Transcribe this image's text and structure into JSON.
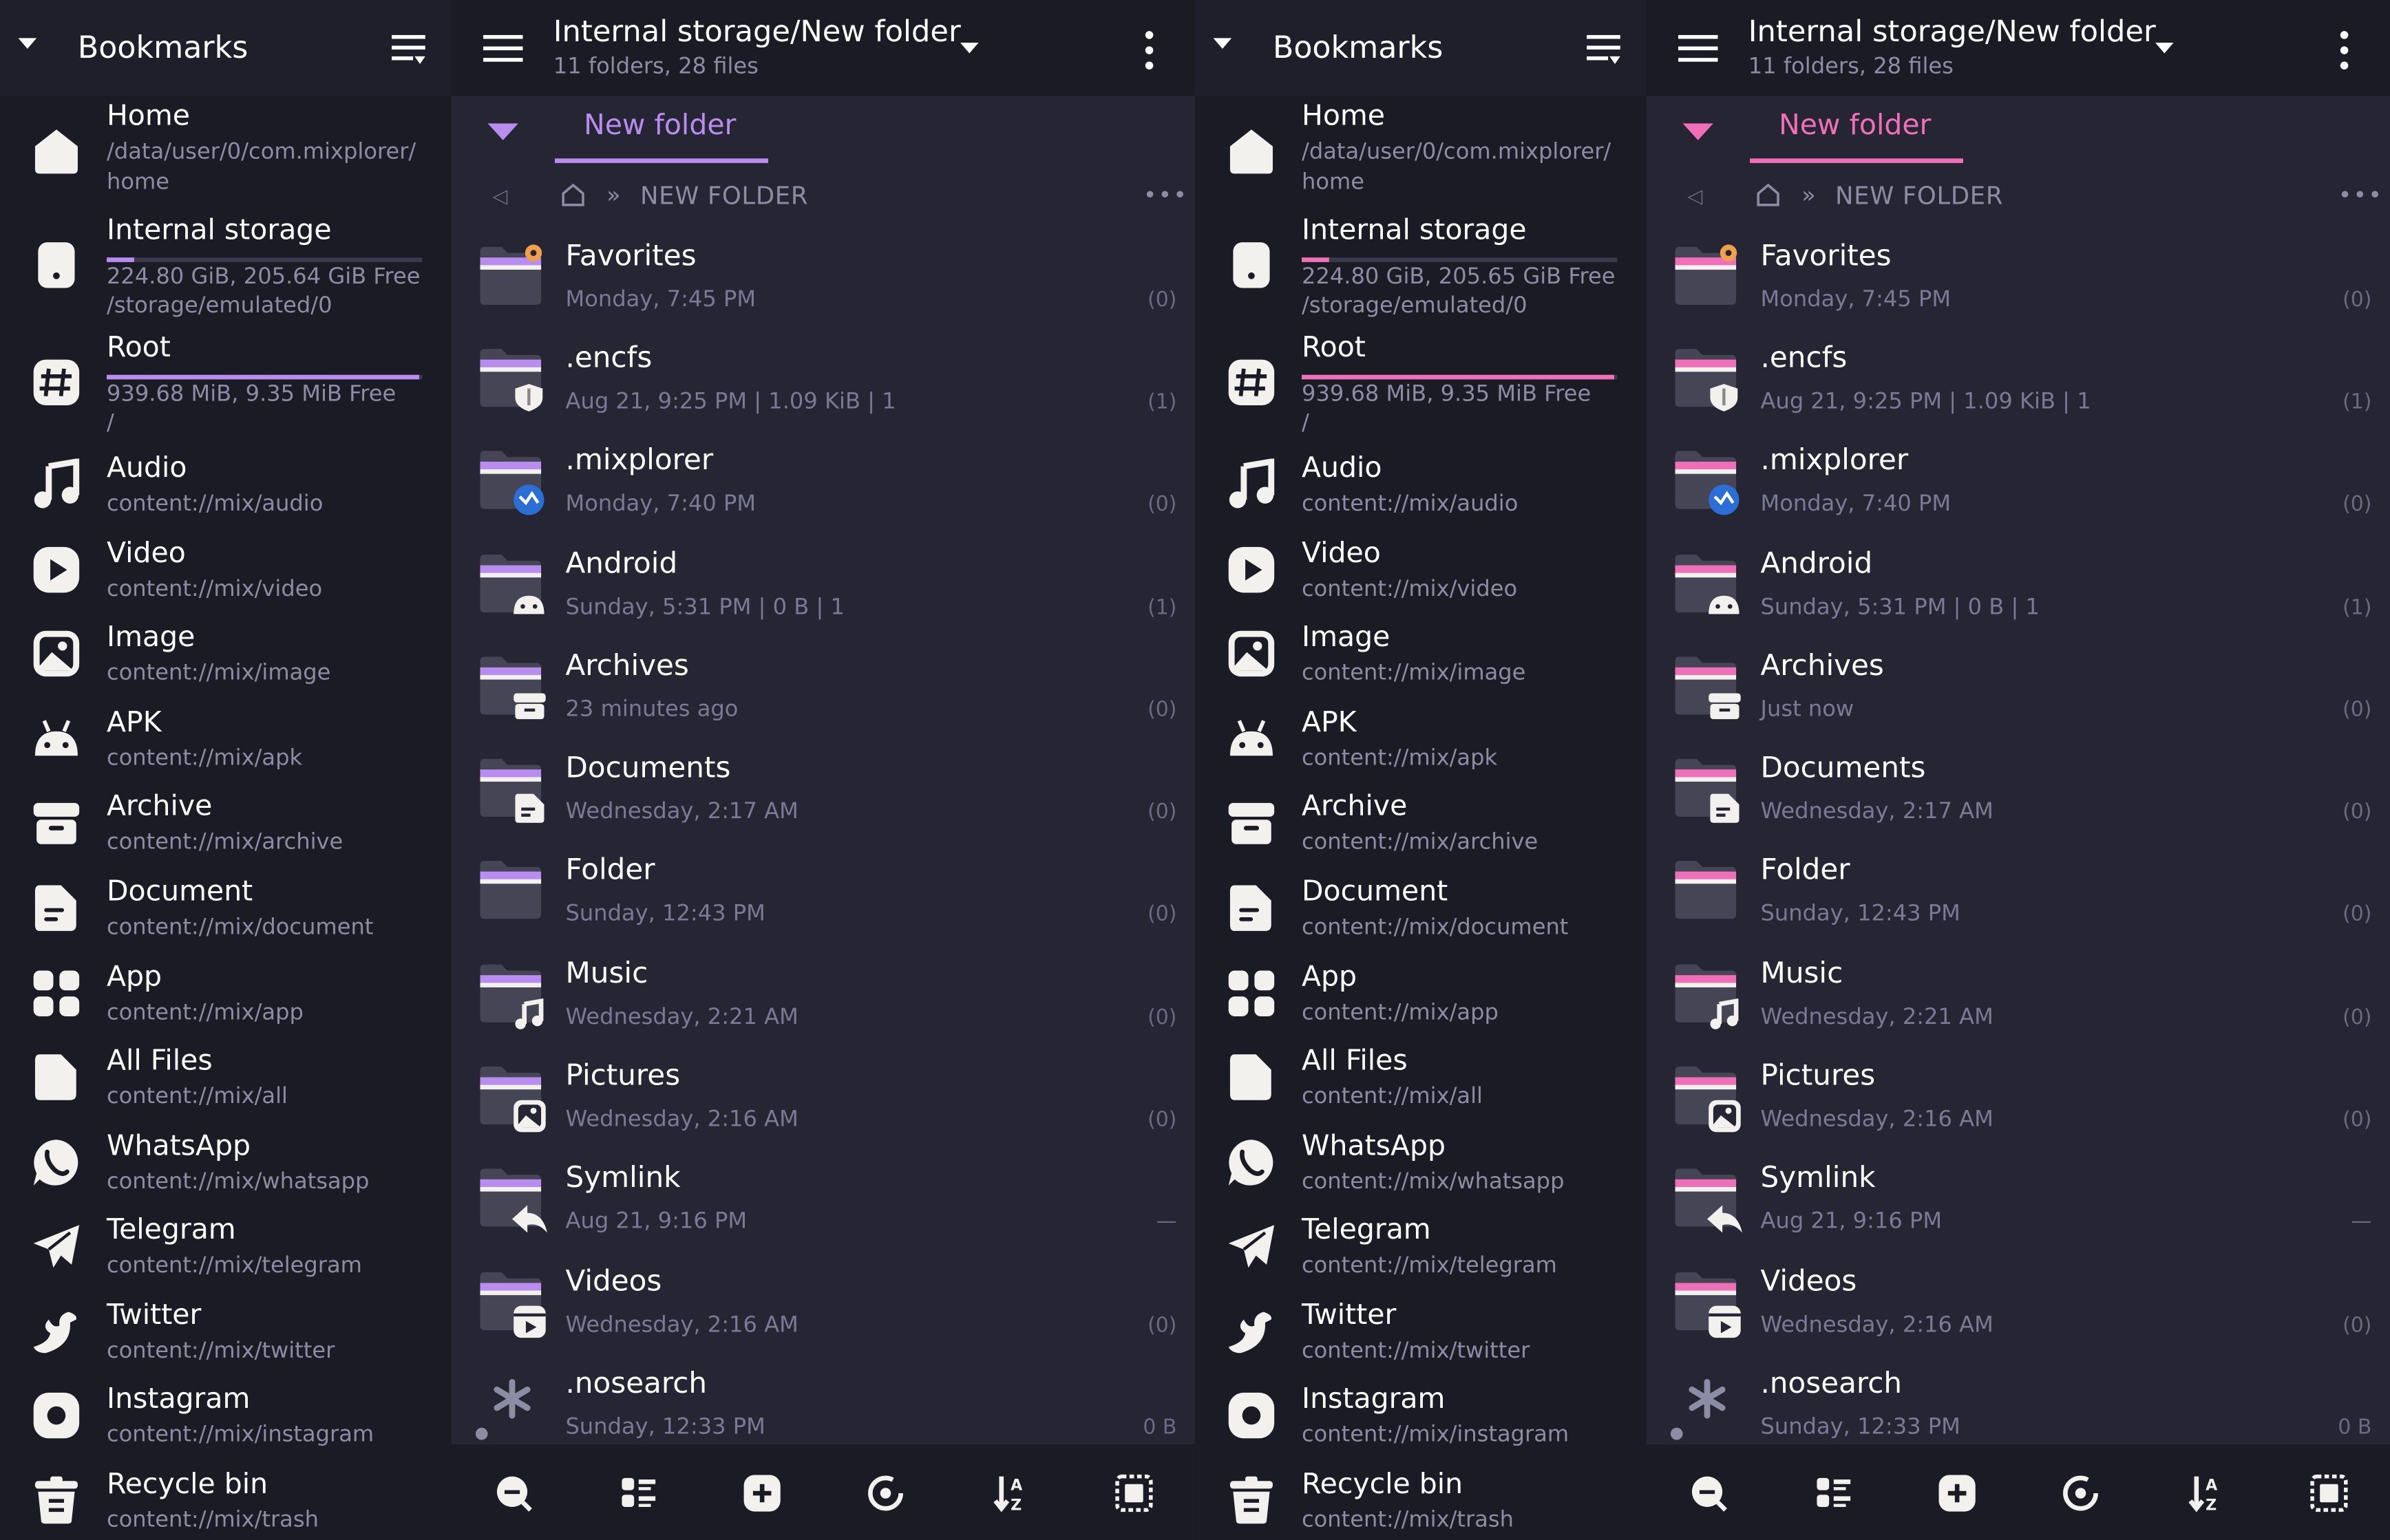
{
  "accents": {
    "left": "#b98cf0",
    "right": "#f06fb9"
  },
  "sidebar": {
    "title": "Bookmarks",
    "items": [
      {
        "icon": "home-icon",
        "name": "Home",
        "sub": "/data/user/0/com.mixplorer/",
        "sub2": "home"
      },
      {
        "icon": "phone-storage-icon",
        "name": "Internal storage",
        "sub": "224.80 GiB,  205.64 GiB Free",
        "sub2": "/storage/emulated/0",
        "usage": 0.085
      },
      {
        "icon": "hash-root-icon",
        "name": "Root",
        "sub": "939.68 MiB,  9.35 MiB Free",
        "sub2": "/",
        "usage": 0.99
      },
      {
        "icon": "music-note-icon",
        "name": "Audio",
        "sub": "content://mix/audio"
      },
      {
        "icon": "play-video-icon",
        "name": "Video",
        "sub": "content://mix/video"
      },
      {
        "icon": "image-icon",
        "name": "Image",
        "sub": "content://mix/image"
      },
      {
        "icon": "android-apk-icon",
        "name": "APK",
        "sub": "content://mix/apk"
      },
      {
        "icon": "archive-box-icon",
        "name": "Archive",
        "sub": "content://mix/archive"
      },
      {
        "icon": "document-icon",
        "name": "Document",
        "sub": "content://mix/document"
      },
      {
        "icon": "app-grid-icon",
        "name": "App",
        "sub": "content://mix/app"
      },
      {
        "icon": "all-files-icon",
        "name": "All Files",
        "sub": "content://mix/all"
      },
      {
        "icon": "whatsapp-icon",
        "name": "WhatsApp",
        "sub": "content://mix/whatsapp"
      },
      {
        "icon": "telegram-icon",
        "name": "Telegram",
        "sub": "content://mix/telegram"
      },
      {
        "icon": "twitter-bird-icon",
        "name": "Twitter",
        "sub": "content://mix/twitter"
      },
      {
        "icon": "instagram-icon",
        "name": "Instagram",
        "sub": "content://mix/instagram"
      },
      {
        "icon": "recycle-bin-icon",
        "name": "Recycle bin",
        "sub": "content://mix/trash"
      }
    ]
  },
  "sidebar_right": {
    "internal_sub": "224.80 GiB,  205.65 GiB Free"
  },
  "panel": {
    "path": "Internal storage/New folder",
    "counts": "11 folders, 28 files",
    "tab": "New folder",
    "crumb_back": "◁",
    "crumb_sep": "»",
    "crumb": "NEW FOLDER",
    "crumb_more": "•••",
    "rows": [
      {
        "icon": "favorites-folder-icon",
        "name": "Favorites",
        "meta": "Monday, 7:45 PM",
        "right": "(0)"
      },
      {
        "icon": "encrypted-folder-icon",
        "name": ".encfs",
        "meta": "Aug 21, 9:25 PM | 1.09  KiB | 1",
        "right": "(1)"
      },
      {
        "icon": "mixplorer-folder-icon",
        "name": ".mixplorer",
        "meta": "Monday, 7:40 PM",
        "right": "(0)"
      },
      {
        "icon": "android-folder-icon",
        "name": "Android",
        "meta": "Sunday, 5:31 PM | 0 B | 1",
        "right": "(1)"
      },
      {
        "icon": "archives-folder-icon",
        "name": "Archives",
        "meta": "23 minutes ago",
        "meta_right": "Just now",
        "right": "(0)"
      },
      {
        "icon": "documents-folder-icon",
        "name": "Documents",
        "meta": "Wednesday, 2:17 AM",
        "right": "(0)"
      },
      {
        "icon": "folder-icon",
        "name": "Folder",
        "meta": "Sunday, 12:43 PM",
        "right": "(0)"
      },
      {
        "icon": "music-folder-icon",
        "name": "Music",
        "meta": "Wednesday, 2:21 AM",
        "right": "(0)"
      },
      {
        "icon": "pictures-folder-icon",
        "name": "Pictures",
        "meta": "Wednesday, 2:16 AM",
        "right": "(0)"
      },
      {
        "icon": "symlink-folder-icon",
        "name": "Symlink",
        "meta": "Aug 21, 9:16 PM",
        "right": "—"
      },
      {
        "icon": "videos-folder-icon",
        "name": "Videos",
        "meta": "Wednesday, 2:16 AM",
        "right": "(0)"
      },
      {
        "icon": "asterisk-file-icon",
        "name": ".nosearch",
        "meta": "Sunday, 12:33 PM",
        "right": "0 B"
      }
    ],
    "toolbar": [
      "search-icon",
      "view-mode-icon",
      "add-icon",
      "history-icon",
      "sort-az-icon",
      "select-all-icon"
    ]
  }
}
